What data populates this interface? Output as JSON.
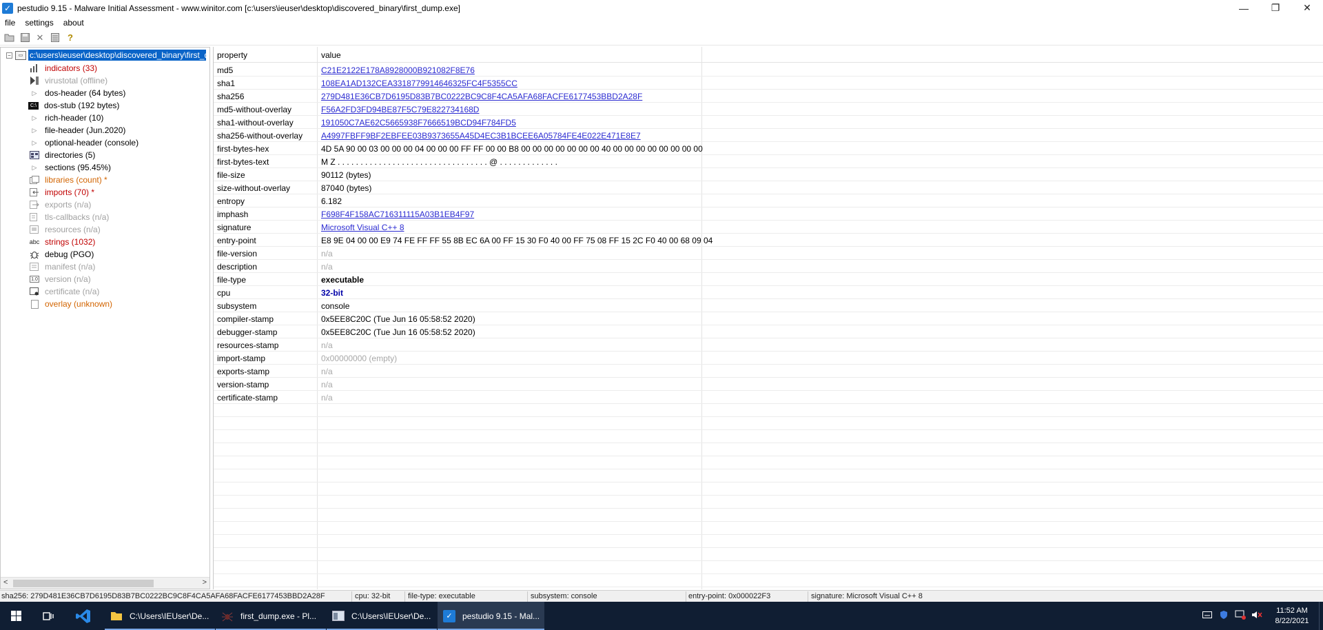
{
  "window": {
    "title": "pestudio 9.15 - Malware Initial Assessment - www.winitor.com [c:\\users\\ieuser\\desktop\\discovered_binary\\first_dump.exe]",
    "controls": {
      "minimize": "—",
      "maximize": "❐",
      "close": "✕"
    }
  },
  "menu": [
    "file",
    "settings",
    "about"
  ],
  "toolbar": [
    "open-icon",
    "save-icon",
    "close-icon",
    "list-icon",
    "help-icon"
  ],
  "tree": {
    "root_label": "c:\\users\\ieuser\\desktop\\discovered_binary\\first_dump.exe",
    "items": [
      {
        "label": "indicators (33)",
        "color": "red",
        "icon": "bars-icon"
      },
      {
        "label": "virustotal (offline)",
        "color": "gray",
        "icon": "virustotal-icon"
      },
      {
        "label": "dos-header (64 bytes)",
        "color": "black",
        "icon": "triangle-icon"
      },
      {
        "label": "dos-stub (192 bytes)",
        "color": "black",
        "icon": "dos-icon"
      },
      {
        "label": "rich-header (10)",
        "color": "black",
        "icon": "triangle-icon"
      },
      {
        "label": "file-header (Jun.2020)",
        "color": "black",
        "icon": "triangle-icon"
      },
      {
        "label": "optional-header (console)",
        "color": "black",
        "icon": "triangle-icon"
      },
      {
        "label": "directories (5)",
        "color": "black",
        "icon": "directories-icon"
      },
      {
        "label": "sections (95.45%)",
        "color": "black",
        "icon": "triangle-icon"
      },
      {
        "label": "libraries (count) *",
        "color": "orange",
        "icon": "libraries-icon"
      },
      {
        "label": "imports (70) *",
        "color": "red",
        "icon": "imports-icon"
      },
      {
        "label": "exports (n/a)",
        "color": "gray",
        "icon": "exports-icon"
      },
      {
        "label": "tls-callbacks (n/a)",
        "color": "gray",
        "icon": "tls-icon"
      },
      {
        "label": "resources (n/a)",
        "color": "gray",
        "icon": "resources-icon"
      },
      {
        "label": "strings (1032)",
        "color": "red",
        "icon": "abc-icon"
      },
      {
        "label": "debug (PGO)",
        "color": "black",
        "icon": "bug-icon"
      },
      {
        "label": "manifest (n/a)",
        "color": "gray",
        "icon": "manifest-icon"
      },
      {
        "label": "version (n/a)",
        "color": "gray",
        "icon": "version-icon"
      },
      {
        "label": "certificate (n/a)",
        "color": "gray",
        "icon": "certificate-icon"
      },
      {
        "label": "overlay (unknown)",
        "color": "orange",
        "icon": "overlay-icon"
      }
    ]
  },
  "grid": {
    "headers": {
      "property": "property",
      "value": "value"
    },
    "rows": [
      {
        "property": "md5",
        "value": "C21E2122E178A8928000B921082F8E76",
        "style": "link"
      },
      {
        "property": "sha1",
        "value": "108EA1AD132CEA3318779914646325FC4F5355CC",
        "style": "link"
      },
      {
        "property": "sha256",
        "value": "279D481E36CB7D6195D83B7BC0222BC9C8F4CA5AFA68FACFE6177453BBD2A28F",
        "style": "link"
      },
      {
        "property": "md5-without-overlay",
        "value": "F56A2FD3FD94BE87F5C79E822734168D",
        "style": "link"
      },
      {
        "property": "sha1-without-overlay",
        "value": "191050C7AE62C5665938F7666519BCD94F784FD5",
        "style": "link"
      },
      {
        "property": "sha256-without-overlay",
        "value": "A4997FBFF9BF2EBFEE03B9373655A45D4EC3B1BCEE6A05784FE4E022E471E8E7",
        "style": "link"
      },
      {
        "property": "first-bytes-hex",
        "value": "4D 5A 90 00 03 00 00 00 04 00 00 00 FF FF 00 00 B8 00 00 00 00 00 00 00 40 00 00 00 00 00 00 00 00",
        "style": "normal"
      },
      {
        "property": "first-bytes-text",
        "value": "M Z . . . . . . . . . . . . . . . . . . . . . . . . . . . . . . . . . @ . . . . . . . . . . . . .",
        "style": "normal"
      },
      {
        "property": "file-size",
        "value": "90112 (bytes)",
        "style": "normal"
      },
      {
        "property": "size-without-overlay",
        "value": "87040 (bytes)",
        "style": "normal"
      },
      {
        "property": "entropy",
        "value": "6.182",
        "style": "normal"
      },
      {
        "property": "imphash",
        "value": "F698F4F158AC716311115A03B1EB4F97",
        "style": "link"
      },
      {
        "property": "signature",
        "value": "Microsoft Visual C++ 8",
        "style": "link"
      },
      {
        "property": "entry-point",
        "value": "E8 9E 04 00 00 E9 74 FE FF FF 55 8B EC 6A 00 FF 15 30 F0 40 00 FF 75 08 FF 15 2C F0 40 00 68 09 04",
        "style": "normal"
      },
      {
        "property": "file-version",
        "value": "n/a",
        "style": "gray"
      },
      {
        "property": "description",
        "value": "n/a",
        "style": "gray"
      },
      {
        "property": "file-type",
        "value": "executable",
        "style": "bold"
      },
      {
        "property": "cpu",
        "value": "32-bit",
        "style": "bold-blue"
      },
      {
        "property": "subsystem",
        "value": "console",
        "style": "normal"
      },
      {
        "property": "compiler-stamp",
        "value": "0x5EE8C20C (Tue Jun 16 05:58:52 2020)",
        "style": "normal"
      },
      {
        "property": "debugger-stamp",
        "value": "0x5EE8C20C (Tue Jun 16 05:58:52 2020)",
        "style": "normal"
      },
      {
        "property": "resources-stamp",
        "value": "n/a",
        "style": "gray"
      },
      {
        "property": "import-stamp",
        "value": "0x00000000 (empty)",
        "style": "gray"
      },
      {
        "property": "exports-stamp",
        "value": "n/a",
        "style": "gray"
      },
      {
        "property": "version-stamp",
        "value": "n/a",
        "style": "gray"
      },
      {
        "property": "certificate-stamp",
        "value": "n/a",
        "style": "gray"
      }
    ]
  },
  "statusbar": {
    "sha256": "sha256: 279D481E36CB7D6195D83B7BC0222BC9C8F4CA5AFA68FACFE6177453BBD2A28F",
    "cpu": "cpu: 32-bit",
    "file_type": "file-type: executable",
    "subsystem": "subsystem: console",
    "entry_point": "entry-point: 0x000022F3",
    "signature": "signature: Microsoft Visual C++ 8"
  },
  "taskbar": {
    "apps": [
      {
        "label": "C:\\Users\\IEUser\\De...",
        "icon": "folder-icon"
      },
      {
        "label": "first_dump.exe - Pl...",
        "icon": "spider-icon"
      },
      {
        "label": "C:\\Users\\IEUser\\De...",
        "icon": "window-icon"
      },
      {
        "label": "pestudio 9.15 - Mal...",
        "icon": "pestudio-icon"
      }
    ],
    "time": "11:52 AM",
    "date": "8/22/2021"
  },
  "colors": {
    "selection": "#0a64c8",
    "red": "#c00000",
    "gray": "#a0a0a0",
    "orange": "#d26400",
    "link": "#2b2bd1",
    "taskbar": "#101e33"
  }
}
